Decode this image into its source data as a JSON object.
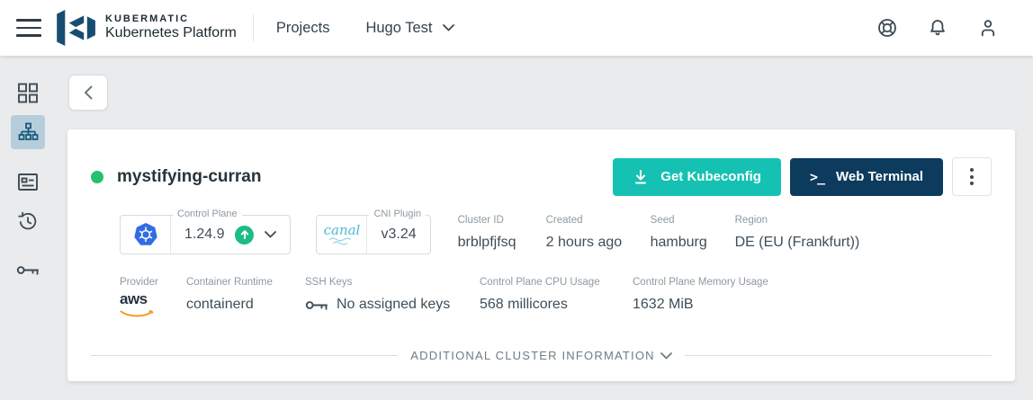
{
  "header": {
    "brand_name": "KUBERMATIC",
    "brand_sub": "Kubernetes Platform",
    "projects": "Projects",
    "project": "Hugo Test"
  },
  "cluster": {
    "name": "mystifying-curran",
    "kubeconfig_btn": "Get Kubeconfig",
    "terminal_btn": "Web Terminal",
    "terminal_glyph": ">_"
  },
  "info": {
    "control_plane": {
      "label": "Control Plane",
      "value": "1.24.9"
    },
    "cni": {
      "label": "CNI Plugin",
      "value": "v3.24",
      "logo_text": "canal"
    },
    "cluster_id": {
      "label": "Cluster ID",
      "value": "brblpfjfsq"
    },
    "created": {
      "label": "Created",
      "value": "2 hours ago"
    },
    "seed": {
      "label": "Seed",
      "value": "hamburg"
    },
    "region": {
      "label": "Region",
      "value": "DE (EU (Frankfurt))"
    },
    "provider": {
      "label": "Provider",
      "value": "aws"
    },
    "runtime": {
      "label": "Container Runtime",
      "value": "containerd"
    },
    "ssh": {
      "label": "SSH Keys",
      "value": "No assigned keys"
    },
    "cpu": {
      "label": "Control Plane CPU Usage",
      "value": "568 millicores"
    },
    "memory": {
      "label": "Control Plane Memory Usage",
      "value": "1632 MiB"
    }
  },
  "footer": {
    "additional": "ADDITIONAL CLUSTER INFORMATION"
  },
  "colors": {
    "accent_teal": "#15c1b2",
    "navy": "#0d3b5e",
    "status_green": "#25c16f",
    "upgrade_green": "#1bbd84",
    "k8s_blue": "#326ce5",
    "aws_orange": "#f7981f",
    "canal_blue": "#4fb9d3",
    "sidebar_selected_bg": "#b6cedb",
    "background_gray": "#e9ebed"
  }
}
